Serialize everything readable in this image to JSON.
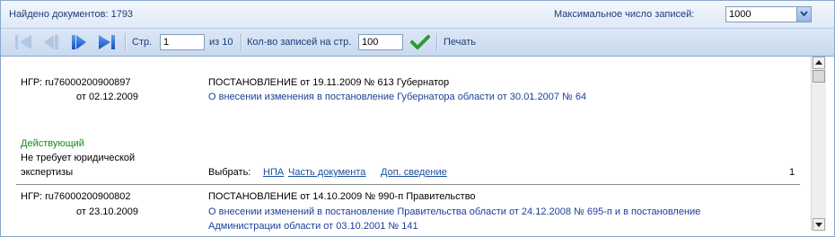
{
  "header": {
    "found_label": "Найдено документов: 1793",
    "max_records_label": "Максимальное число записей:",
    "max_records_value": "1000"
  },
  "toolbar": {
    "page_label": "Стр.",
    "page_value": "1",
    "page_of": "из 10",
    "per_page_label": "Кол-во записей на стр.",
    "per_page_value": "100",
    "print_label": "Печать"
  },
  "records": [
    {
      "ngr": "НГР: ru76000200900897",
      "date": "от 02.12.2009",
      "title": "ПОСТАНОВЛЕНИЕ от 19.11.2009 № 613 Губернатор",
      "subject": "О внесении изменения в постановление Губернатора области от 30.01.2007 № 64",
      "status": "Действующий",
      "expertise_line1": "Не требует юридической",
      "expertise_line2": "экспертизы",
      "choose_label": "Выбрать:",
      "link_npa": "НПА",
      "link_part": "Часть документа",
      "link_info": "Доп. сведение",
      "number": "1"
    },
    {
      "ngr": "НГР: ru76000200900802",
      "date": "от 23.10.2009",
      "title": "ПОСТАНОВЛЕНИЕ от 14.10.2009 № 990-п Правительство",
      "subject_line1": "О внесении изменений в постановление Правительства области от 24.12.2008 № 695-п и в постановление",
      "subject_line2": "Администрации области от 03.10.2001 № 141"
    }
  ],
  "icons": {
    "first": "first-page-icon",
    "prev": "prev-page-icon",
    "next": "next-page-icon",
    "last": "last-page-icon",
    "apply": "checkmark-icon"
  }
}
